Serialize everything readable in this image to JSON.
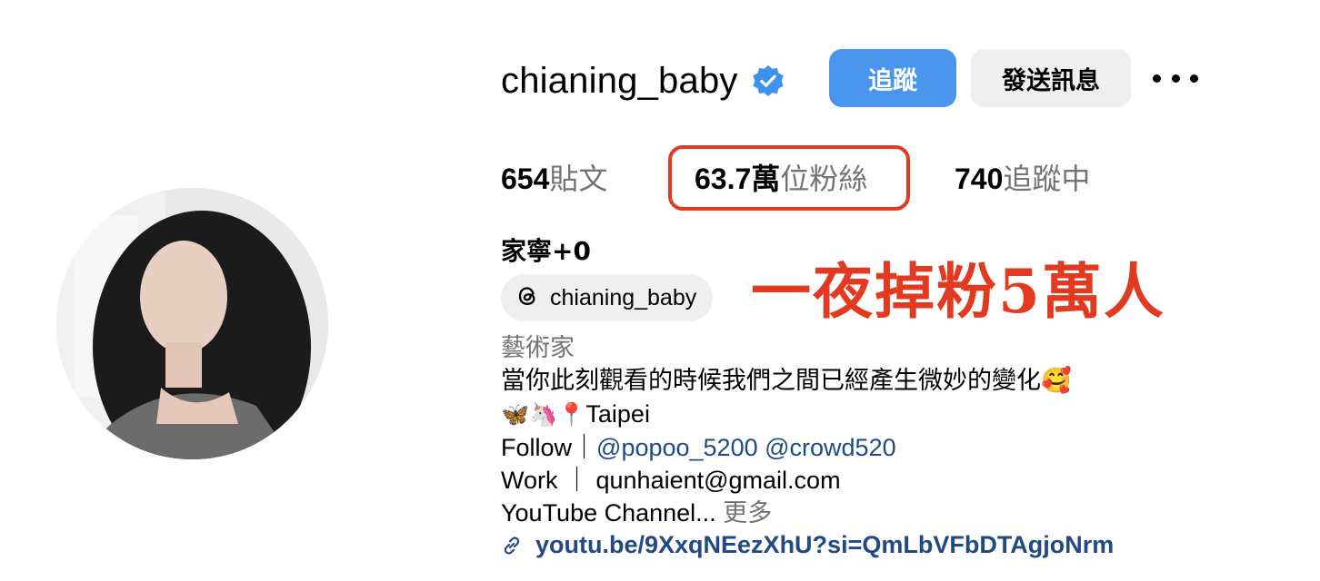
{
  "profile": {
    "username": "chianing_baby",
    "verified_icon": "verified-badge-icon",
    "follow_label": "追蹤",
    "message_label": "發送訊息",
    "more_icon": "more-options-icon"
  },
  "stats": {
    "posts_count": "654",
    "posts_label": "貼文",
    "followers_count": "63.7萬",
    "followers_label": "位粉絲",
    "following_count": "740",
    "following_label": "追蹤中"
  },
  "display_name": "家寧+0",
  "threads": {
    "icon": "threads-icon",
    "handle": "chianing_baby"
  },
  "overlay_caption": "一夜掉粉5萬人",
  "bio": {
    "category": "藝術家",
    "line1": "當你此刻觀看的時候我們之間已經產生微妙的變化🥰",
    "line2_emojis": "🦋🦄📍",
    "line2_text": "Taipei",
    "follow_prefix": "Follow｜",
    "mention1": "@popoo_5200",
    "mention2": "@crowd520",
    "work_line": "Work ｜ qunhaient@gmail.com",
    "youtube_line": "YouTube Channel...",
    "more_label": "更多"
  },
  "link": {
    "icon": "link-icon",
    "url": "youtu.be/9XxqNEezXhU?si=QmLbVFbDTAgjoNrm"
  },
  "colors": {
    "follow_button": "#4a95ee",
    "message_button": "#efefef",
    "highlight": "#e23a20",
    "link_text": "#1f4a84",
    "muted_text": "#737373"
  }
}
